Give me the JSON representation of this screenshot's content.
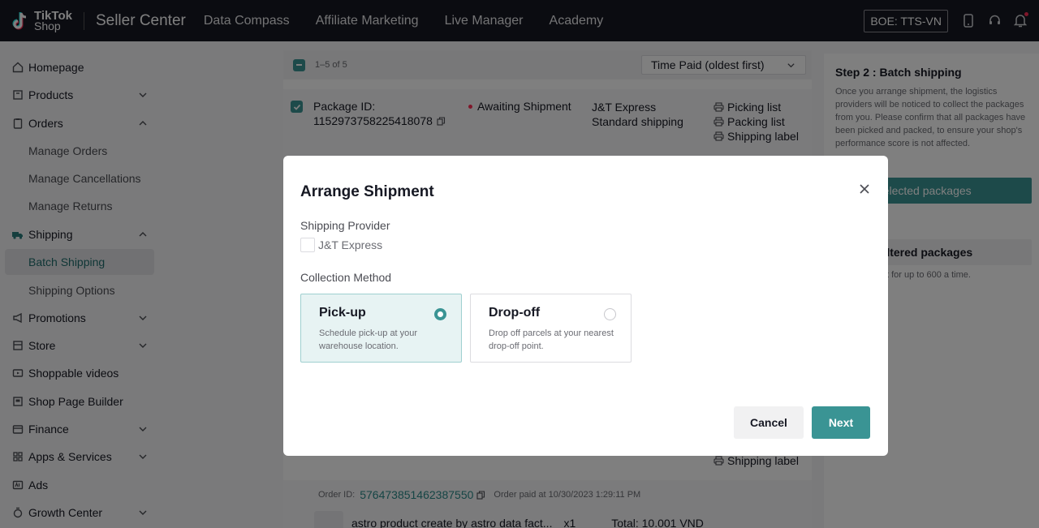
{
  "topbar": {
    "logo_line1": "TikTok",
    "logo_line2": "Shop",
    "product": "Seller Center",
    "nav": [
      "Data Compass",
      "Affiliate Marketing",
      "Live Manager",
      "Academy"
    ],
    "region": "BOE: TTS-VN"
  },
  "sidebar": {
    "items": [
      {
        "label": "Homepage",
        "icon": "home-icon"
      },
      {
        "label": "Products",
        "icon": "box-icon"
      },
      {
        "label": "Orders",
        "icon": "clipboard-icon"
      },
      {
        "label": "Manage Orders"
      },
      {
        "label": "Manage Cancellations"
      },
      {
        "label": "Manage Returns"
      },
      {
        "label": "Shipping",
        "icon": "truck-icon"
      },
      {
        "label": "Batch Shipping"
      },
      {
        "label": "Shipping Options"
      },
      {
        "label": "Promotions",
        "icon": "megaphone-icon"
      },
      {
        "label": "Store",
        "icon": "store-icon"
      },
      {
        "label": "Shoppable videos",
        "icon": "video-icon"
      },
      {
        "label": "Shop Page Builder",
        "icon": "builder-icon"
      },
      {
        "label": "Finance",
        "icon": "wallet-icon"
      },
      {
        "label": "Apps & Services",
        "icon": "apps-icon"
      },
      {
        "label": "Ads",
        "icon": "ads-icon"
      },
      {
        "label": "Growth Center",
        "icon": "growth-icon"
      }
    ]
  },
  "list": {
    "count": "1–5 of 5",
    "sort": "Time Paid (oldest first)",
    "package": {
      "id_label": "Package ID:",
      "id": "1152973758225418078",
      "status": "Awaiting Shipment",
      "carrier": "J&T Express",
      "service": "Standard shipping",
      "docs": [
        "Picking list",
        "Packing list",
        "Shipping label"
      ]
    },
    "bottom_label": "Shipping label",
    "order": {
      "label": "Order ID:",
      "id": "576473851462387550",
      "paid": "Order paid at 10/30/2023 1:29:11 PM",
      "product": "astro product create by astro data fact...",
      "qty": "x1",
      "total": "Total: 10.001 VND"
    }
  },
  "panel": {
    "title": "Step 2 : Batch shipping",
    "desc": "Once you arrange shipment, the logistics providers will be noticed to collect the packages from you. Please confirm that all packages have been picked and packed, to ensure your shop's performance score is not affected.",
    "sec1": "packages",
    "btn1": "ge for selected packages",
    "sec2": "packages",
    "btn2": "ge for filtered packages",
    "note": "nge shipment for up to 600 a time."
  },
  "modal": {
    "title": "Arrange Shipment",
    "provider_label": "Shipping Provider",
    "provider_value": "J&T Express",
    "method_label": "Collection Method",
    "methods": [
      {
        "title": "Pick-up",
        "desc": "Schedule pick-up at your warehouse location.",
        "selected": true
      },
      {
        "title": "Drop-off",
        "desc": "Drop off parcels at your nearest drop-off point.",
        "selected": false
      }
    ],
    "cancel": "Cancel",
    "next": "Next"
  }
}
